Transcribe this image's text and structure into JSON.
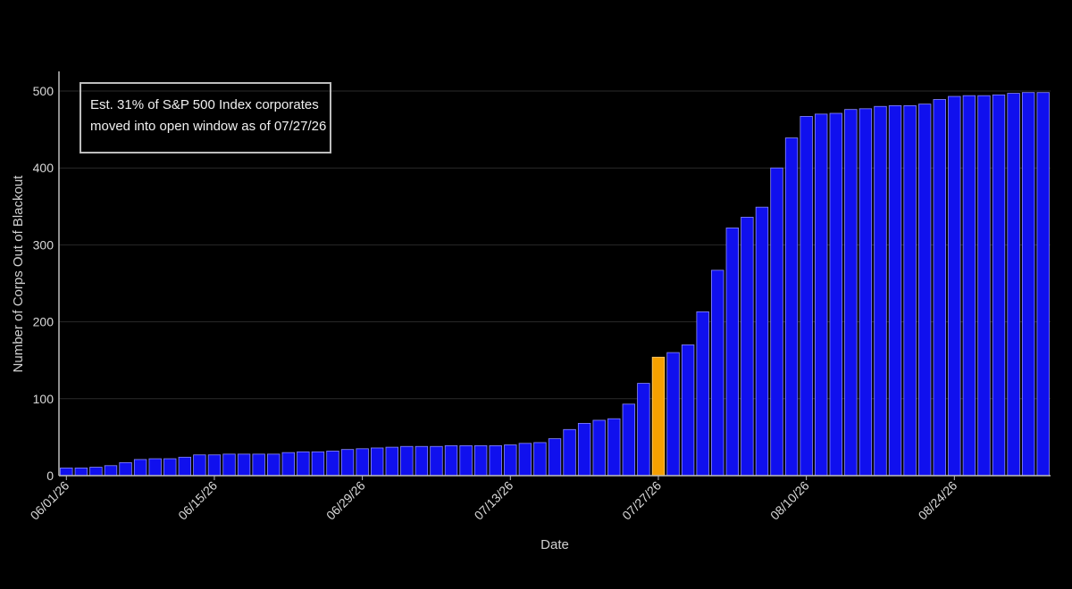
{
  "chart_data": {
    "type": "bar",
    "xlabel": "Date",
    "ylabel": "Number of Corps Out of Blackout",
    "ylim": [
      0,
      500
    ],
    "yticks": [
      0,
      100,
      200,
      300,
      400,
      500
    ],
    "xtick_labels": [
      "06/01/26",
      "06/15/26",
      "06/29/26",
      "07/13/26",
      "07/27/26",
      "08/10/26",
      "08/24/26"
    ],
    "xtick_indices": [
      0,
      10,
      20,
      30,
      40,
      50,
      60
    ],
    "grid": true,
    "highlight_index": 40,
    "bar_color": "#1010ee",
    "highlight_color": "#f5a000",
    "annotation": {
      "line1": "Est. 31% of S&P 500 Index corporates",
      "line2": "moved into open window as of 07/27/26"
    },
    "values": [
      10,
      10,
      11,
      13,
      17,
      21,
      22,
      22,
      24,
      27,
      27,
      28,
      28,
      28,
      28,
      30,
      31,
      31,
      32,
      34,
      35,
      36,
      37,
      38,
      38,
      38,
      39,
      39,
      39,
      39,
      40,
      42,
      43,
      48,
      60,
      68,
      72,
      74,
      93,
      120,
      154,
      160,
      170,
      213,
      267,
      322,
      336,
      349,
      400,
      439,
      467,
      470,
      471,
      476,
      477,
      480,
      481,
      481,
      483,
      489,
      493,
      494,
      494,
      495,
      497,
      498,
      498
    ]
  }
}
